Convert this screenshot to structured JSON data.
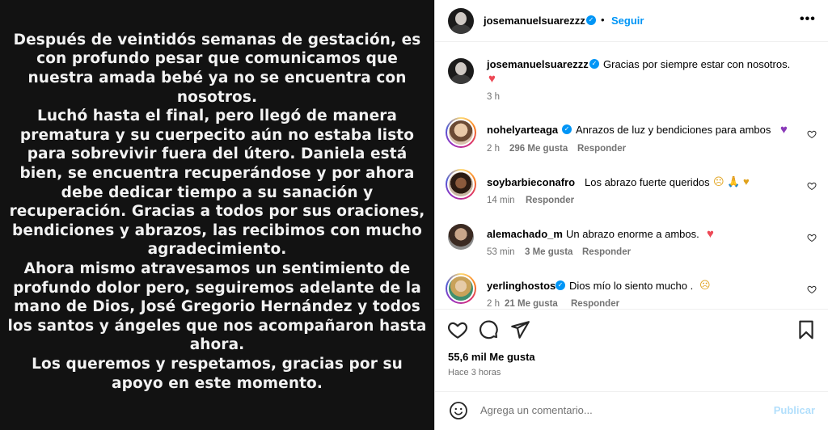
{
  "media": {
    "paragraphs": [
      "Después de veintidós semanas de gestación, es con profundo pesar que comunicamos que nuestra amada bebé ya no se encuentra con nosotros.",
      "Luchó hasta el final, pero llegó de manera prematura y su cuerpecito aún no estaba listo para sobrevivir fuera del útero. Daniela está bien, se encuentra recuperándose y por ahora debe dedicar tiempo a su sanación y recuperación. Gracias a todos por sus oraciones, bendiciones y abrazos, las recibimos con mucho agradecimiento.",
      "Ahora mismo atravesamos un sentimiento de profundo dolor pero, seguiremos adelante de la mano de Dios, José Gregorio Hernández y todos los santos y ángeles que nos acompañaron hasta ahora.",
      "Los queremos y respetamos, gracias por su apoyo en este momento."
    ]
  },
  "header": {
    "username": "josemanuelsuarezzz",
    "separator": "•",
    "follow_label": "Seguir",
    "more_label": "•••"
  },
  "caption": {
    "username": "josemanuelsuarezzz",
    "text": "Gracias por siempre estar con nosotros.",
    "emoji": "♥",
    "time": "3 h"
  },
  "comments": [
    {
      "username": "nohelyarteaga",
      "verified": true,
      "text": "Anrazos de luz y bendiciones para ambos",
      "emoji": "♥",
      "time": "2 h",
      "likes": "296 Me gusta",
      "reply": "Responder"
    },
    {
      "username": "soybarbieconafro",
      "verified": false,
      "text": "Los abrazo fuerte queridos",
      "emoji": "☹ 🙏 ♥",
      "time": "14 min",
      "likes": "",
      "reply": "Responder"
    },
    {
      "username": "alemachado_m",
      "verified": false,
      "text": "Un abrazo enorme a ambos.",
      "emoji": "♥",
      "time": "53 min",
      "likes": "3 Me gusta",
      "reply": "Responder"
    },
    {
      "username": "yerlinghostos",
      "verified": true,
      "text": "Dios mío lo siento mucho .",
      "emoji": "☹",
      "time": "2 h",
      "likes": "21 Me gusta",
      "reply": "Responder"
    }
  ],
  "actions": {
    "likes": "55,6 mil Me gusta",
    "posted": "Hace 3 horas"
  },
  "compose": {
    "placeholder": "Agrega un comentario...",
    "publish_label": "Publicar"
  },
  "colors": {
    "accent": "#0095f6",
    "heart": "#ed4956",
    "purple_heart": "#8a3ab9",
    "muted": "#737373"
  }
}
